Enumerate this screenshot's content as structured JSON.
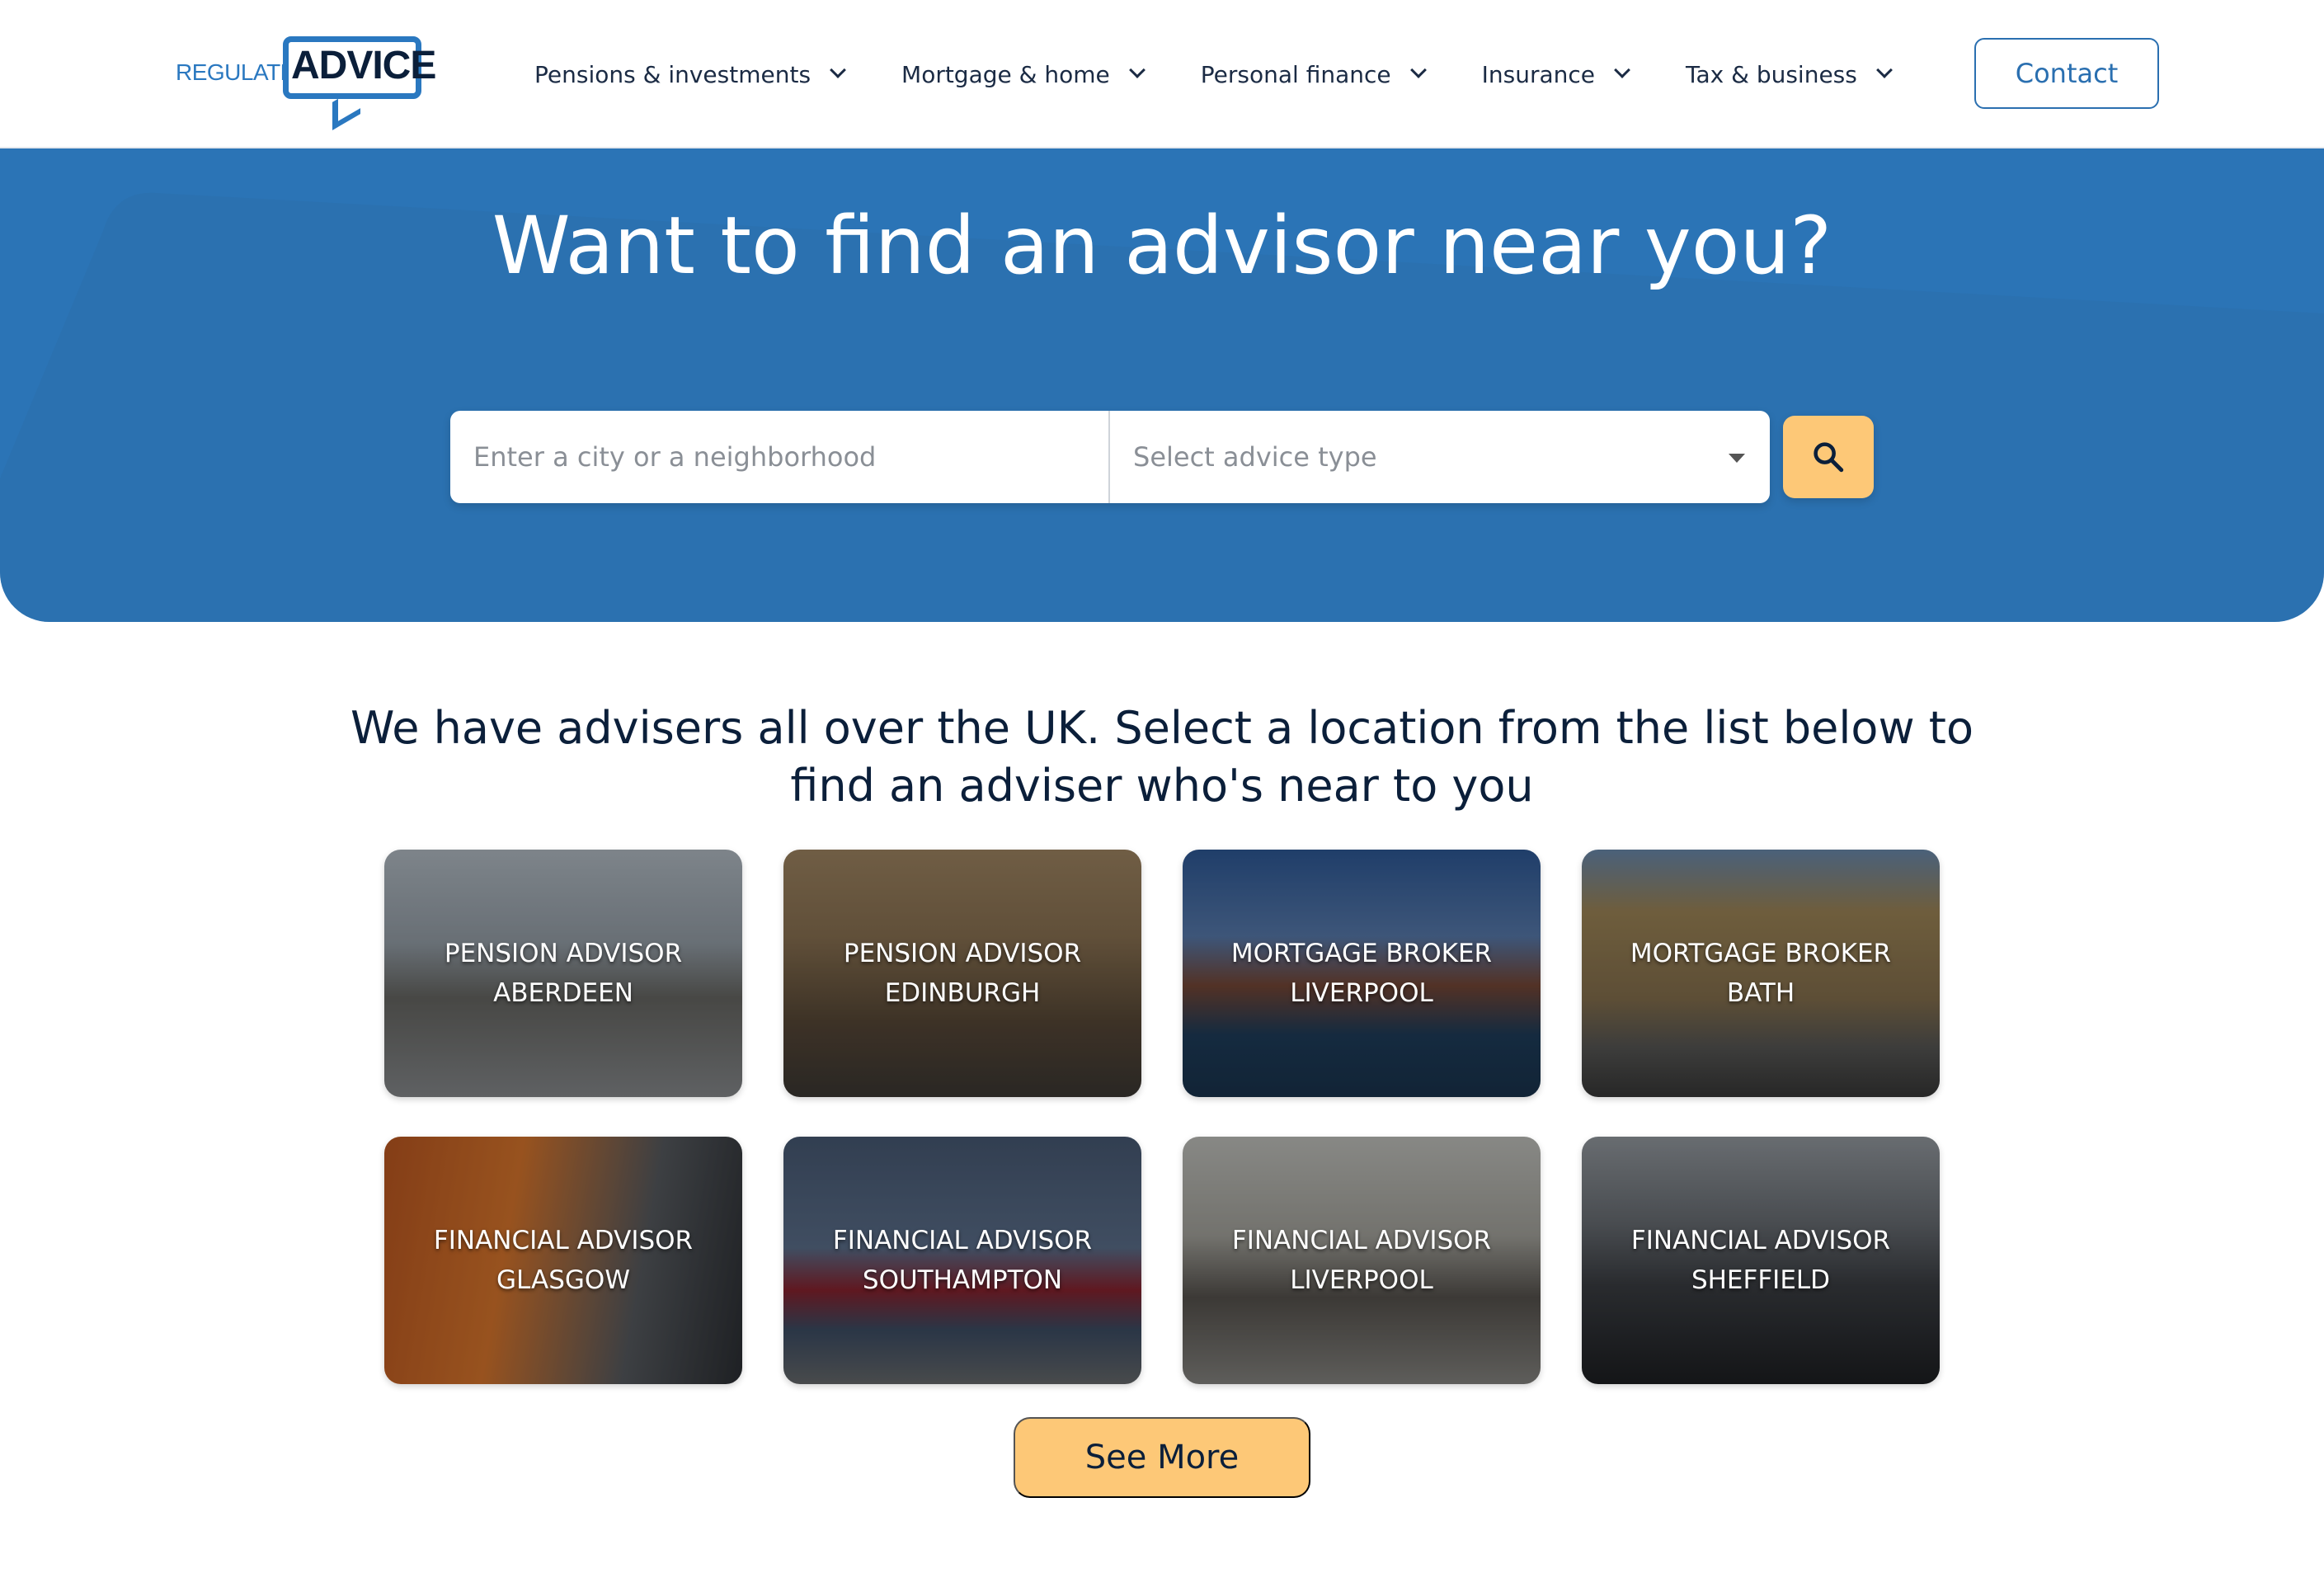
{
  "header": {
    "logo": {
      "small": "REGULATED",
      "big": "ADVICE"
    },
    "nav": [
      {
        "label": "Pensions & investments"
      },
      {
        "label": "Mortgage & home"
      },
      {
        "label": "Personal finance"
      },
      {
        "label": "Insurance"
      },
      {
        "label": "Tax & business"
      }
    ],
    "contact_label": "Contact"
  },
  "hero": {
    "title": "Want to find an advisor near you?",
    "search": {
      "location_placeholder": "Enter a city or a neighborhood",
      "location_value": "",
      "advice_type_placeholder": "Select advice type",
      "button_icon": "search-icon"
    }
  },
  "main": {
    "intro_line1": "We have advisers all over the UK. Select a location from the list below to",
    "intro_line2": "find an adviser who's near to you",
    "locations": [
      {
        "line1": "PENSION ADVISOR",
        "line2": "ABERDEEN"
      },
      {
        "line1": "PENSION ADVISOR",
        "line2": "EDINBURGH"
      },
      {
        "line1": "MORTGAGE BROKER",
        "line2": "LIVERPOOL"
      },
      {
        "line1": "MORTGAGE BROKER",
        "line2": "BATH"
      },
      {
        "line1": "FINANCIAL ADVISOR",
        "line2": "GLASGOW"
      },
      {
        "line1": "FINANCIAL ADVISOR",
        "line2": "SOUTHAMPTON"
      },
      {
        "line1": "FINANCIAL ADVISOR",
        "line2": "LIVERPOOL"
      },
      {
        "line1": "FINANCIAL ADVISOR",
        "line2": "SHEFFIELD"
      }
    ],
    "see_more_label": "See More"
  },
  "colors": {
    "brand_blue": "#2b74b6",
    "accent_yellow": "#fdc877",
    "text_dark": "#0b1f3a"
  }
}
